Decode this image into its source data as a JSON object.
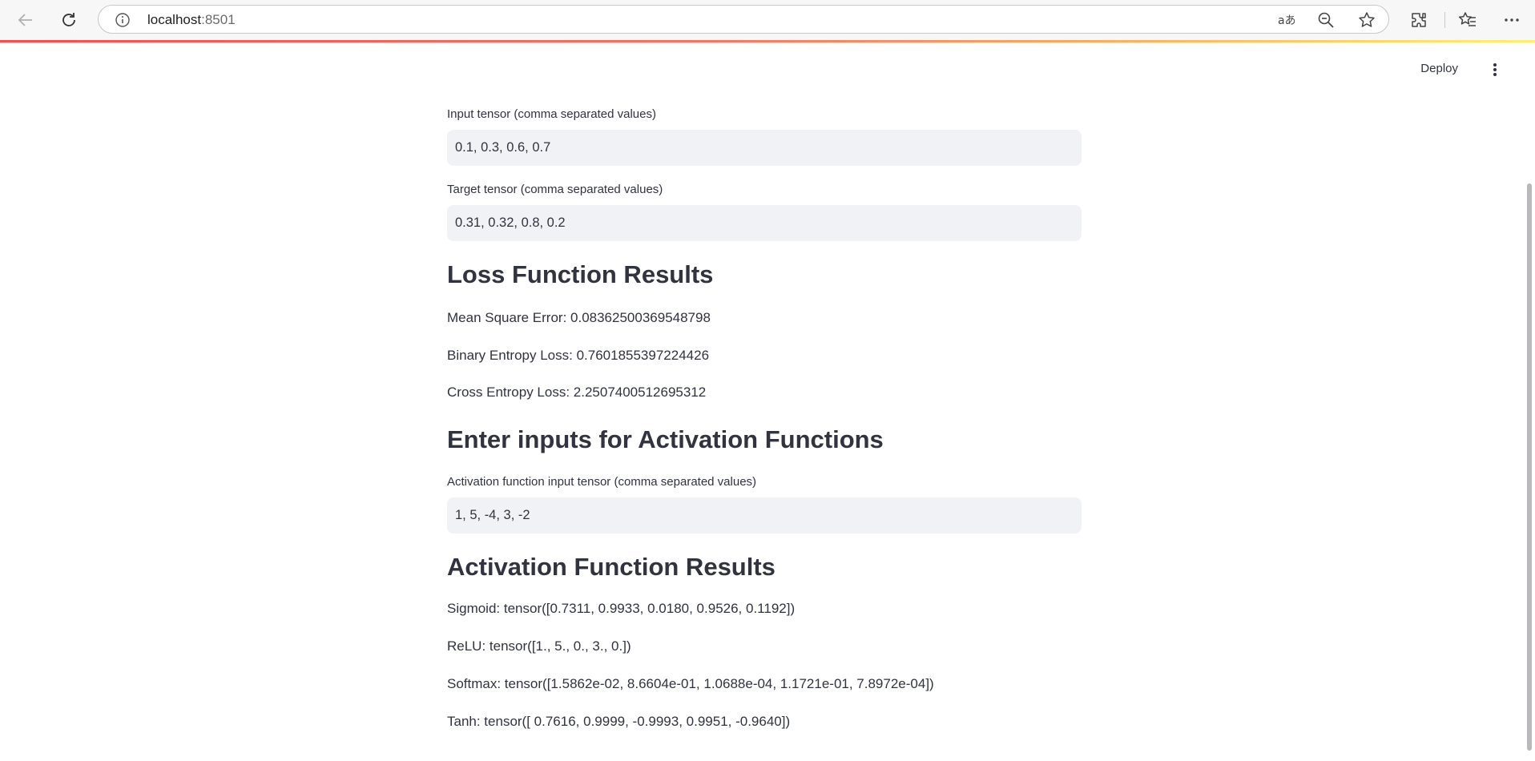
{
  "browser": {
    "url_host": "localhost",
    "url_port": ":8501"
  },
  "header": {
    "deploy_label": "Deploy"
  },
  "loss_inputs": {
    "input_label": "Input tensor (comma separated values)",
    "input_value": "0.1, 0.3, 0.6, 0.7",
    "target_label": "Target tensor (comma separated values)",
    "target_value": "0.31, 0.32, 0.8, 0.2"
  },
  "loss_results": {
    "heading": "Loss Function Results",
    "mse": "Mean Square Error: 0.08362500369548798",
    "bce": "Binary Entropy Loss: 0.7601855397224426",
    "ce": "Cross Entropy Loss: 2.2507400512695312"
  },
  "activation_inputs": {
    "heading": "Enter inputs for Activation Functions",
    "input_label": "Activation function input tensor (comma separated values)",
    "input_value": "1, 5, -4, 3, -2"
  },
  "activation_results": {
    "heading": "Activation Function Results",
    "sigmoid": "Sigmoid: tensor([0.7311, 0.9933, 0.0180, 0.9526, 0.1192])",
    "relu": "ReLU: tensor([1., 5., 0., 3., 0.])",
    "softmax": "Softmax: tensor([1.5862e-02, 8.6604e-01, 1.0688e-04, 1.1721e-01, 7.8972e-04])",
    "tanh": "Tanh: tensor([ 0.7616, 0.9999, -0.9993, 0.9951, -0.9640])"
  },
  "colors": {
    "accent": "#ff4b4b",
    "input_bg": "#f0f2f6",
    "text": "#31333f"
  },
  "icons": [
    "back-arrow-icon",
    "reload-icon",
    "info-icon",
    "translate-icon",
    "zoom-out-icon",
    "star-icon",
    "extensions-icon",
    "favorites-icon",
    "more-icon",
    "kebab-menu-icon"
  ]
}
